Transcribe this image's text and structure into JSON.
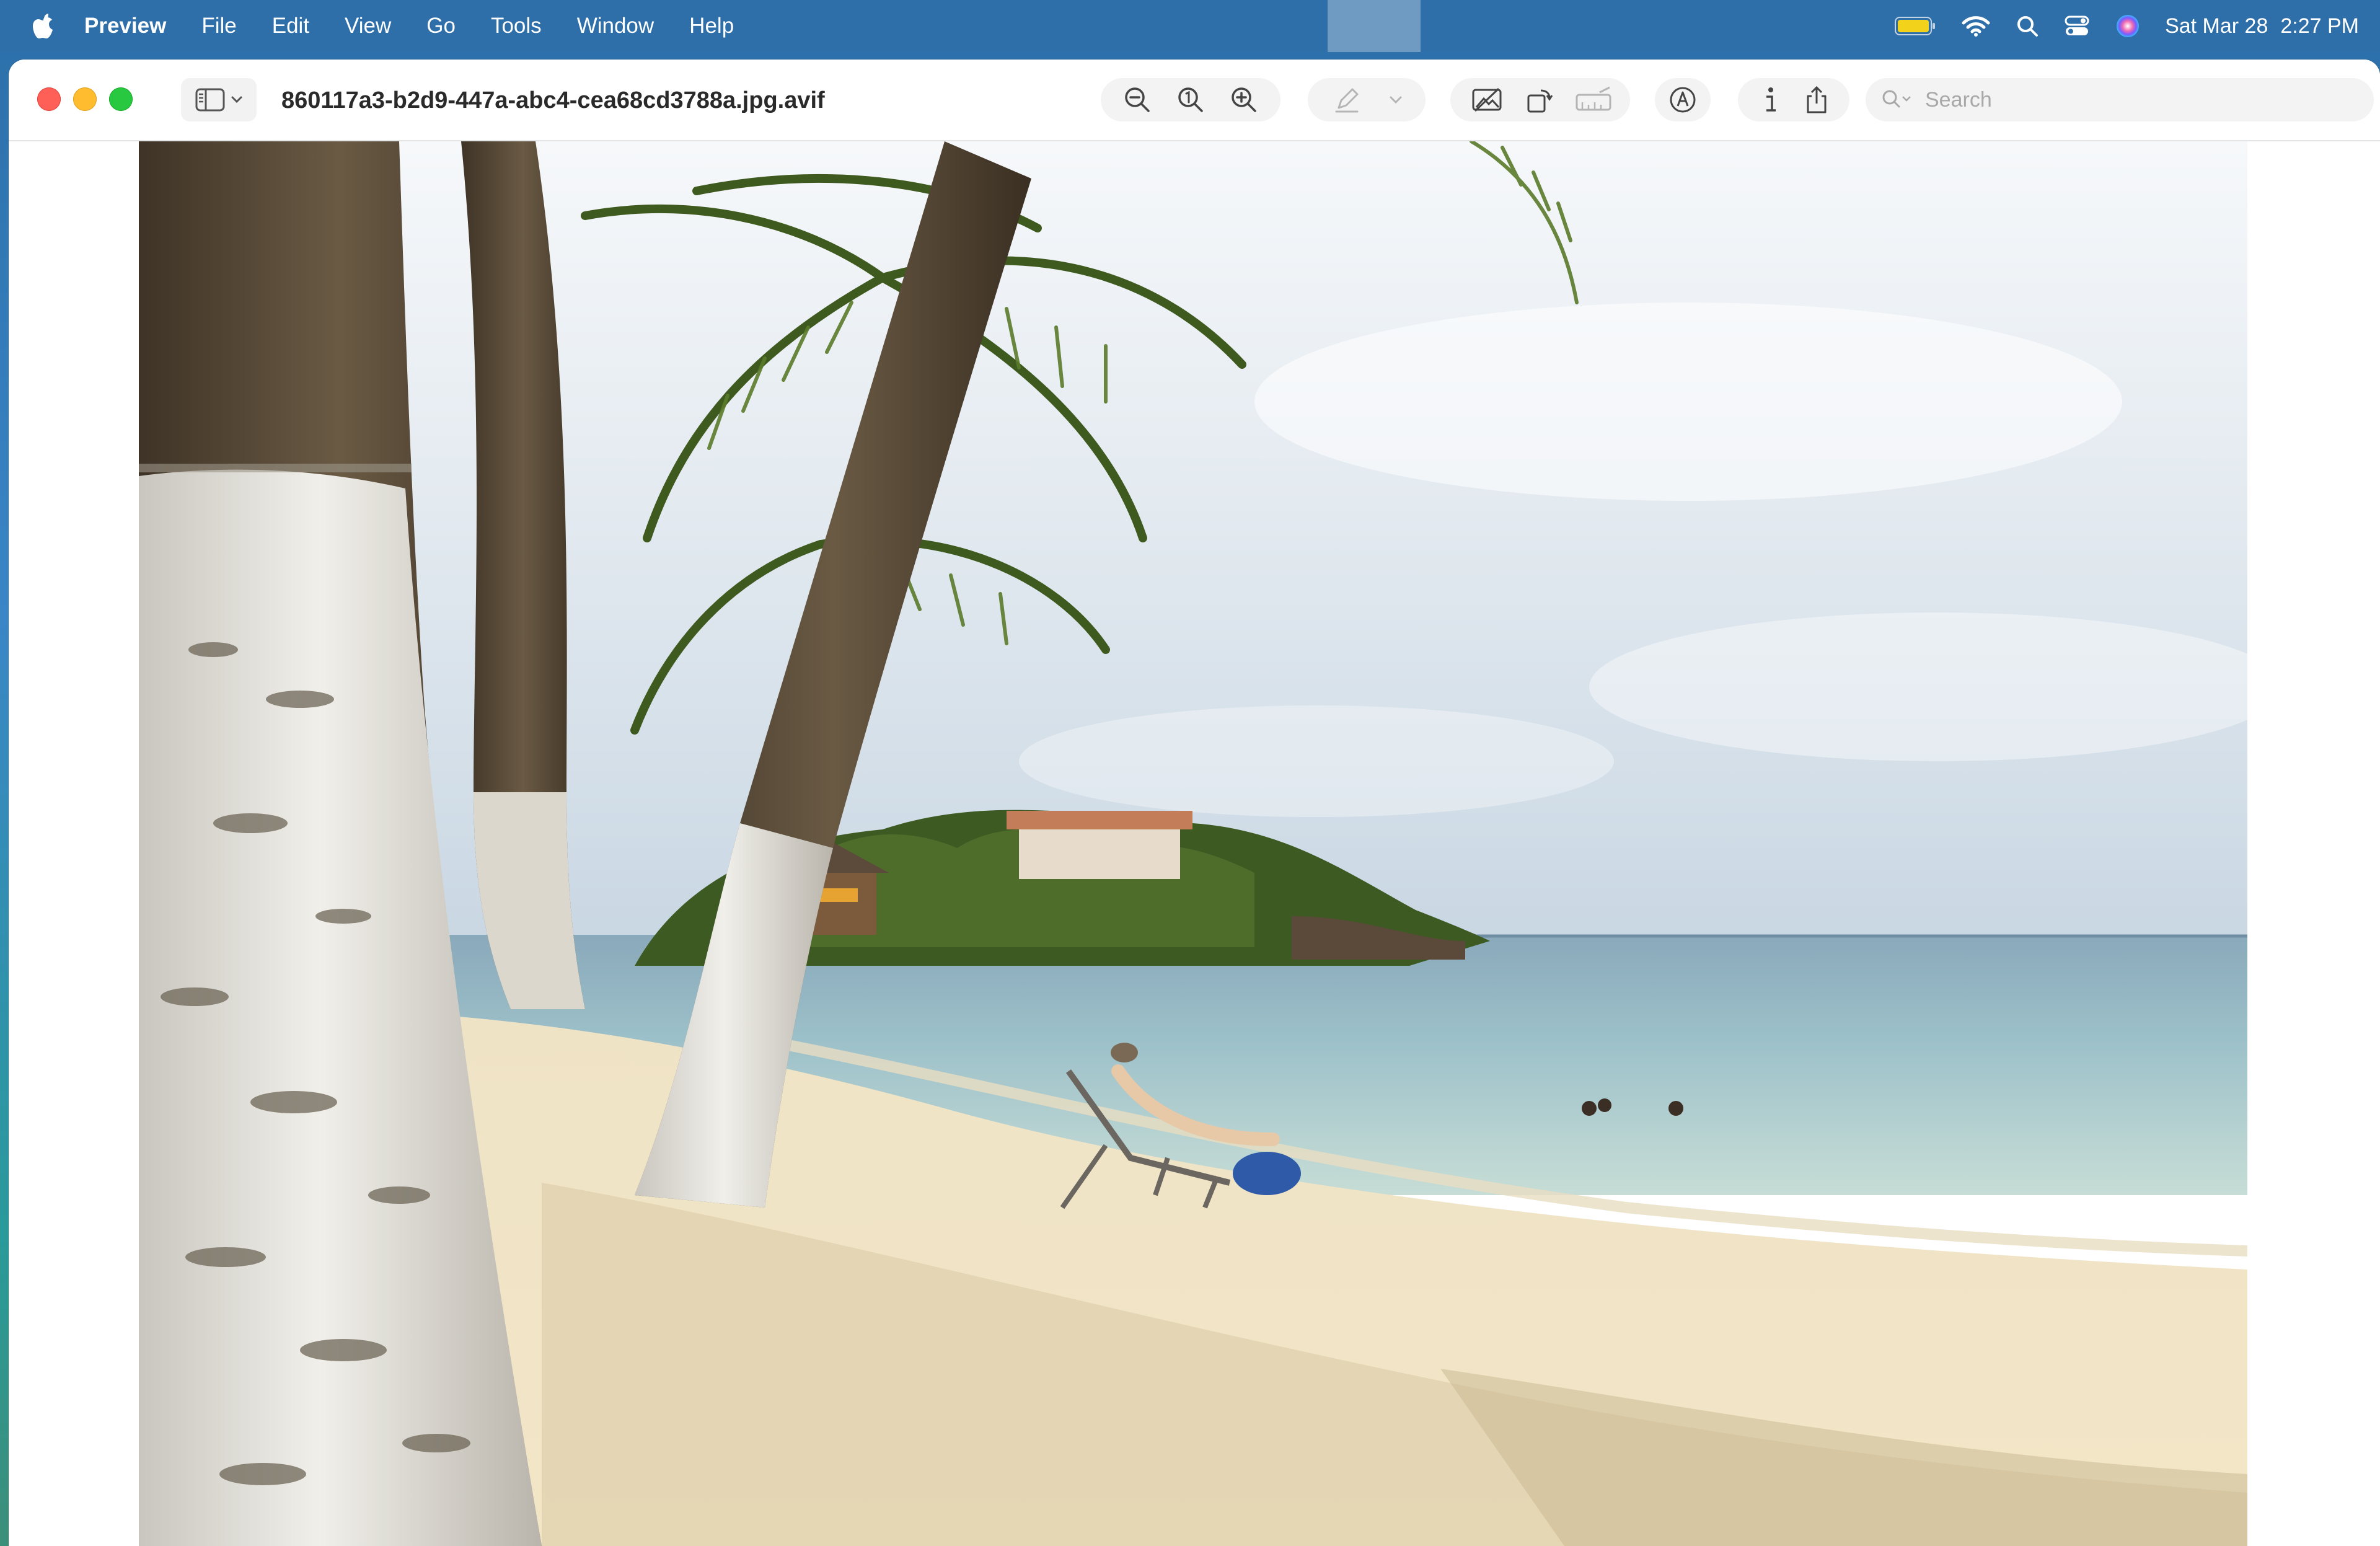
{
  "menubar": {
    "app_name": "Preview",
    "items": [
      "File",
      "Edit",
      "View",
      "Go",
      "Tools",
      "Window",
      "Help"
    ],
    "clock_date": "Sat Mar 28",
    "clock_time": "2:27 PM",
    "status_icons": [
      "battery-icon",
      "wifi-icon",
      "spotlight-search-icon",
      "control-center-icon",
      "siri-icon"
    ]
  },
  "window": {
    "title": "860117a3-b2d9-447a-abc4-cea68cd3788a.jpg.avif",
    "toolbar": {
      "sidebar_toggle": "sidebar-icon",
      "zoom_buttons": [
        "zoom-out-icon",
        "actual-size-icon",
        "zoom-in-icon"
      ],
      "markup_buttons": [
        "highlight-pen-icon",
        "chevron-down-icon"
      ],
      "edit_buttons": [
        "adjust-color-icon",
        "rotate-icon",
        "crop-resize-icon"
      ],
      "annotate": "markup-icon",
      "info": "info-icon",
      "share": "share-icon"
    },
    "search": {
      "placeholder": "Search",
      "value": ""
    }
  },
  "photo": {
    "subject": "beach-photo",
    "colors": {
      "sky": "#dfe7ee",
      "sea": "#8fb8c4",
      "sand": "#f1e2c0",
      "palm_trunk": "#e9e7e2",
      "foliage": "#3f5f22"
    }
  }
}
